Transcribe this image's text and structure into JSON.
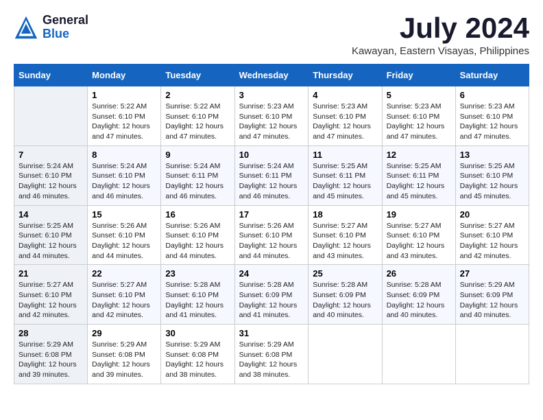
{
  "header": {
    "logo_general": "General",
    "logo_blue": "Blue",
    "title": "July 2024",
    "subtitle": "Kawayan, Eastern Visayas, Philippines"
  },
  "days_of_week": [
    "Sunday",
    "Monday",
    "Tuesday",
    "Wednesday",
    "Thursday",
    "Friday",
    "Saturday"
  ],
  "weeks": [
    [
      {
        "day": "",
        "sunrise": "",
        "sunset": "",
        "daylight": ""
      },
      {
        "day": "1",
        "sunrise": "Sunrise: 5:22 AM",
        "sunset": "Sunset: 6:10 PM",
        "daylight": "Daylight: 12 hours and 47 minutes."
      },
      {
        "day": "2",
        "sunrise": "Sunrise: 5:22 AM",
        "sunset": "Sunset: 6:10 PM",
        "daylight": "Daylight: 12 hours and 47 minutes."
      },
      {
        "day": "3",
        "sunrise": "Sunrise: 5:23 AM",
        "sunset": "Sunset: 6:10 PM",
        "daylight": "Daylight: 12 hours and 47 minutes."
      },
      {
        "day": "4",
        "sunrise": "Sunrise: 5:23 AM",
        "sunset": "Sunset: 6:10 PM",
        "daylight": "Daylight: 12 hours and 47 minutes."
      },
      {
        "day": "5",
        "sunrise": "Sunrise: 5:23 AM",
        "sunset": "Sunset: 6:10 PM",
        "daylight": "Daylight: 12 hours and 47 minutes."
      },
      {
        "day": "6",
        "sunrise": "Sunrise: 5:23 AM",
        "sunset": "Sunset: 6:10 PM",
        "daylight": "Daylight: 12 hours and 47 minutes."
      }
    ],
    [
      {
        "day": "7",
        "sunrise": "Sunrise: 5:24 AM",
        "sunset": "Sunset: 6:10 PM",
        "daylight": "Daylight: 12 hours and 46 minutes."
      },
      {
        "day": "8",
        "sunrise": "Sunrise: 5:24 AM",
        "sunset": "Sunset: 6:10 PM",
        "daylight": "Daylight: 12 hours and 46 minutes."
      },
      {
        "day": "9",
        "sunrise": "Sunrise: 5:24 AM",
        "sunset": "Sunset: 6:11 PM",
        "daylight": "Daylight: 12 hours and 46 minutes."
      },
      {
        "day": "10",
        "sunrise": "Sunrise: 5:24 AM",
        "sunset": "Sunset: 6:11 PM",
        "daylight": "Daylight: 12 hours and 46 minutes."
      },
      {
        "day": "11",
        "sunrise": "Sunrise: 5:25 AM",
        "sunset": "Sunset: 6:11 PM",
        "daylight": "Daylight: 12 hours and 45 minutes."
      },
      {
        "day": "12",
        "sunrise": "Sunrise: 5:25 AM",
        "sunset": "Sunset: 6:11 PM",
        "daylight": "Daylight: 12 hours and 45 minutes."
      },
      {
        "day": "13",
        "sunrise": "Sunrise: 5:25 AM",
        "sunset": "Sunset: 6:10 PM",
        "daylight": "Daylight: 12 hours and 45 minutes."
      }
    ],
    [
      {
        "day": "14",
        "sunrise": "Sunrise: 5:25 AM",
        "sunset": "Sunset: 6:10 PM",
        "daylight": "Daylight: 12 hours and 44 minutes."
      },
      {
        "day": "15",
        "sunrise": "Sunrise: 5:26 AM",
        "sunset": "Sunset: 6:10 PM",
        "daylight": "Daylight: 12 hours and 44 minutes."
      },
      {
        "day": "16",
        "sunrise": "Sunrise: 5:26 AM",
        "sunset": "Sunset: 6:10 PM",
        "daylight": "Daylight: 12 hours and 44 minutes."
      },
      {
        "day": "17",
        "sunrise": "Sunrise: 5:26 AM",
        "sunset": "Sunset: 6:10 PM",
        "daylight": "Daylight: 12 hours and 44 minutes."
      },
      {
        "day": "18",
        "sunrise": "Sunrise: 5:27 AM",
        "sunset": "Sunset: 6:10 PM",
        "daylight": "Daylight: 12 hours and 43 minutes."
      },
      {
        "day": "19",
        "sunrise": "Sunrise: 5:27 AM",
        "sunset": "Sunset: 6:10 PM",
        "daylight": "Daylight: 12 hours and 43 minutes."
      },
      {
        "day": "20",
        "sunrise": "Sunrise: 5:27 AM",
        "sunset": "Sunset: 6:10 PM",
        "daylight": "Daylight: 12 hours and 42 minutes."
      }
    ],
    [
      {
        "day": "21",
        "sunrise": "Sunrise: 5:27 AM",
        "sunset": "Sunset: 6:10 PM",
        "daylight": "Daylight: 12 hours and 42 minutes."
      },
      {
        "day": "22",
        "sunrise": "Sunrise: 5:27 AM",
        "sunset": "Sunset: 6:10 PM",
        "daylight": "Daylight: 12 hours and 42 minutes."
      },
      {
        "day": "23",
        "sunrise": "Sunrise: 5:28 AM",
        "sunset": "Sunset: 6:10 PM",
        "daylight": "Daylight: 12 hours and 41 minutes."
      },
      {
        "day": "24",
        "sunrise": "Sunrise: 5:28 AM",
        "sunset": "Sunset: 6:09 PM",
        "daylight": "Daylight: 12 hours and 41 minutes."
      },
      {
        "day": "25",
        "sunrise": "Sunrise: 5:28 AM",
        "sunset": "Sunset: 6:09 PM",
        "daylight": "Daylight: 12 hours and 40 minutes."
      },
      {
        "day": "26",
        "sunrise": "Sunrise: 5:28 AM",
        "sunset": "Sunset: 6:09 PM",
        "daylight": "Daylight: 12 hours and 40 minutes."
      },
      {
        "day": "27",
        "sunrise": "Sunrise: 5:29 AM",
        "sunset": "Sunset: 6:09 PM",
        "daylight": "Daylight: 12 hours and 40 minutes."
      }
    ],
    [
      {
        "day": "28",
        "sunrise": "Sunrise: 5:29 AM",
        "sunset": "Sunset: 6:08 PM",
        "daylight": "Daylight: 12 hours and 39 minutes."
      },
      {
        "day": "29",
        "sunrise": "Sunrise: 5:29 AM",
        "sunset": "Sunset: 6:08 PM",
        "daylight": "Daylight: 12 hours and 39 minutes."
      },
      {
        "day": "30",
        "sunrise": "Sunrise: 5:29 AM",
        "sunset": "Sunset: 6:08 PM",
        "daylight": "Daylight: 12 hours and 38 minutes."
      },
      {
        "day": "31",
        "sunrise": "Sunrise: 5:29 AM",
        "sunset": "Sunset: 6:08 PM",
        "daylight": "Daylight: 12 hours and 38 minutes."
      },
      {
        "day": "",
        "sunrise": "",
        "sunset": "",
        "daylight": ""
      },
      {
        "day": "",
        "sunrise": "",
        "sunset": "",
        "daylight": ""
      },
      {
        "day": "",
        "sunrise": "",
        "sunset": "",
        "daylight": ""
      }
    ]
  ]
}
